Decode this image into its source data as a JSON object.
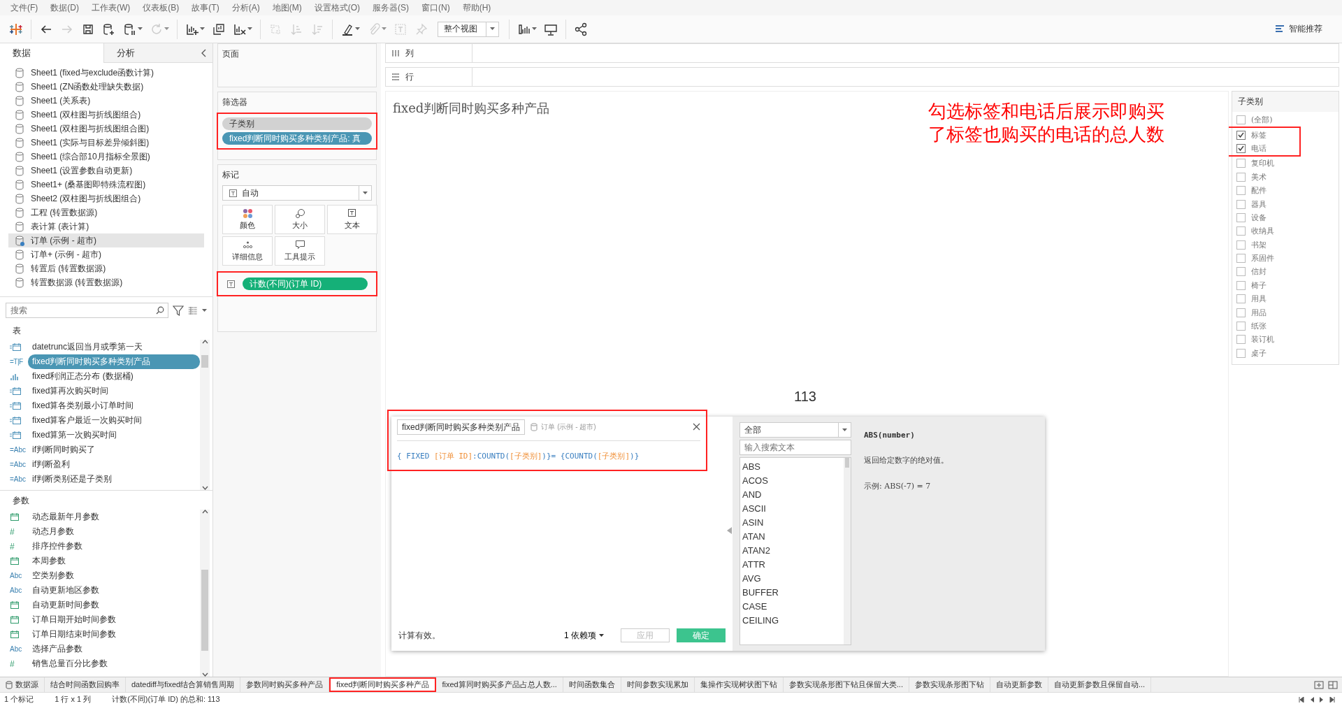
{
  "menu": [
    "文件(F)",
    "数据(D)",
    "工作表(W)",
    "仪表板(B)",
    "故事(T)",
    "分析(A)",
    "地图(M)",
    "设置格式(O)",
    "服务器(S)",
    "窗口(N)",
    "帮助(H)"
  ],
  "toolbar": {
    "items": [
      {
        "disabled": false
      },
      {
        "disabled": false
      },
      {
        "disabled": true
      },
      {
        "disabled": false
      },
      {
        "disabled": false
      },
      {
        "disabled": false
      },
      {
        "disabled": true
      },
      {
        "disabled": false
      },
      {
        "disabled": false
      },
      {
        "disabled": false
      },
      {
        "disabled": true
      },
      {
        "disabled": true
      },
      {
        "disabled": true
      },
      {
        "disabled": false
      },
      {
        "disabled": true
      },
      {
        "disabled": true
      },
      {
        "disabled": true
      },
      {
        "disabled": false
      },
      {
        "disabled": false
      },
      {
        "disabled": false
      },
      {
        "disabled": false
      }
    ],
    "fit_value": "整个视图",
    "show_me": "智能推荐"
  },
  "data_pane": {
    "tabs": [
      {
        "label": "数据",
        "selected": true
      },
      {
        "label": "分析",
        "selected": false
      }
    ],
    "data_sources": [
      {
        "label": "Sheet1 (fixed与exclude函数计算)",
        "selected": false
      },
      {
        "label": "Sheet1 (ZN函数处理缺失数据)",
        "selected": false
      },
      {
        "label": "Sheet1 (关系表)",
        "selected": false
      },
      {
        "label": "Sheet1 (双柱图与折线图组合)",
        "selected": false
      },
      {
        "label": "Sheet1 (双柱图与折线图组合图)",
        "selected": false
      },
      {
        "label": "Sheet1 (实际与目标差异倾斜图)",
        "selected": false
      },
      {
        "label": "Sheet1 (综合部10月指标全景图)",
        "selected": false
      },
      {
        "label": "Sheet1 (设置参数自动更新)",
        "selected": false
      },
      {
        "label": "Sheet1+ (桑基图即特殊流程图)",
        "selected": false
      },
      {
        "label": "Sheet2 (双柱图与折线图组合)",
        "selected": false
      },
      {
        "label": "工程 (转置数据源)",
        "selected": false
      },
      {
        "label": "表计算 (表计算)",
        "selected": false
      },
      {
        "label": "订单 (示例 - 超市)",
        "selected": true
      },
      {
        "label": "订单+ (示例 - 超市)",
        "selected": false
      },
      {
        "label": "转置后 (转置数据源)",
        "selected": false
      },
      {
        "label": "转置数据源 (转置数据源)",
        "selected": false
      }
    ],
    "search": {
      "placeholder": "搜索"
    },
    "tables_heading": "表",
    "fields": [
      {
        "kind": "date-calc",
        "label": "datetrunc返回当月或季第一天",
        "selected": false
      },
      {
        "kind": "bool-calc",
        "badge": "=T|F",
        "label": "fixed判断同时购买多种类别产品",
        "selected": true
      },
      {
        "kind": "bins",
        "label": "fixed利润正态分布 (数据桶)",
        "selected": false
      },
      {
        "kind": "date-calc",
        "label": "fixed算再次购买时间",
        "selected": false
      },
      {
        "kind": "date-calc",
        "label": "fixed算各类别最小订单时间",
        "selected": false
      },
      {
        "kind": "date-calc",
        "label": "fixed算客户最近一次购买时间",
        "selected": false
      },
      {
        "kind": "date-calc",
        "label": "fixed算第一次购买时间",
        "selected": false
      },
      {
        "kind": "string-calc",
        "badge": "=Abc",
        "label": "if判断同时购买了",
        "selected": false
      },
      {
        "kind": "string-calc",
        "badge": "=Abc",
        "label": "if判断盈利",
        "selected": false
      },
      {
        "kind": "string-calc",
        "badge": "=Abc",
        "label": "if判断类别还是子类别",
        "selected": false
      }
    ],
    "params_heading": "参数",
    "parameters": [
      {
        "kind": "date",
        "label": "动态最新年月参数"
      },
      {
        "kind": "number",
        "badge": "#",
        "label": "动态月参数"
      },
      {
        "kind": "number",
        "badge": "#",
        "label": "排序控件参数"
      },
      {
        "kind": "date",
        "label": "本周参数"
      },
      {
        "kind": "string",
        "badge": "Abc",
        "label": "空类别参数"
      },
      {
        "kind": "string",
        "badge": "Abc",
        "label": "自动更新地区参数"
      },
      {
        "kind": "date",
        "label": "自动更新时间参数"
      },
      {
        "kind": "date",
        "label": "订单日期开始时间参数"
      },
      {
        "kind": "date",
        "label": "订单日期结束时间参数"
      },
      {
        "kind": "string",
        "badge": "Abc",
        "label": "选择产品参数"
      },
      {
        "kind": "number",
        "badge": "#",
        "label": "销售总量百分比参数"
      }
    ]
  },
  "pages_card": {
    "title": "页面"
  },
  "filters_card": {
    "title": "筛选器",
    "highlighted": true,
    "pills": [
      {
        "label": "子类别",
        "kind": "dimension"
      },
      {
        "label": "fixed判断同时购买多种类别产品: 真",
        "kind": "calc"
      }
    ]
  },
  "marks_card": {
    "title": "标记",
    "mark_type": "自动",
    "highlighted": true,
    "buttons": [
      "颜色",
      "大小",
      "文本",
      "详细信息",
      "工具提示"
    ],
    "pills": [
      {
        "label": "计数(不同)(订单 ID)",
        "kind": "measure"
      }
    ]
  },
  "columns_shelf": {
    "label": "列"
  },
  "rows_shelf": {
    "label": "行"
  },
  "sheet": {
    "title": "fixed判断同时购买多种产品",
    "value": "113",
    "annotation": [
      "勾选标签和电话后展示即购买",
      "了标签也购买的电话的总人数"
    ]
  },
  "calc_editor": {
    "highlighted": true,
    "name": "fixed判断同时购买多种类别产品",
    "source": "订单 (示例 - 超市)",
    "formula": [
      {
        "kind": "keyword",
        "text": "{ FIXED "
      },
      {
        "kind": "field",
        "text": "[订单 ID]"
      },
      {
        "kind": "keyword",
        "text": ":COUNTD("
      },
      {
        "kind": "field",
        "text": "[子类别]"
      },
      {
        "kind": "keyword",
        "text": ")}= {COUNTD("
      },
      {
        "kind": "field",
        "text": "[子类别]"
      },
      {
        "kind": "keyword",
        "text": ")}"
      }
    ],
    "status": "计算有效。",
    "dependencies": "1 依赖项",
    "apply": "应用",
    "ok": "确定",
    "category": "全部",
    "search_placeholder": "输入搜索文本",
    "functions": [
      "ABS",
      "ACOS",
      "AND",
      "ASCII",
      "ASIN",
      "ATAN",
      "ATAN2",
      "ATTR",
      "AVG",
      "BUFFER",
      "CASE",
      "CEILING"
    ],
    "help_signature": "ABS(number)",
    "help_text": "返回给定数字的绝对值。",
    "help_example": "示例: ABS(-7) = 7"
  },
  "filter_card": {
    "title": "子类别",
    "items": [
      {
        "label": "(全部)",
        "checked": false,
        "highlighted": false
      },
      {
        "label": "标签",
        "checked": true,
        "highlighted": true
      },
      {
        "label": "电话",
        "checked": true,
        "highlighted": true
      },
      {
        "label": "复印机",
        "checked": false,
        "highlighted": false
      },
      {
        "label": "美术",
        "checked": false,
        "highlighted": false
      },
      {
        "label": "配件",
        "checked": false,
        "highlighted": false
      },
      {
        "label": "器具",
        "checked": false,
        "highlighted": false
      },
      {
        "label": "设备",
        "checked": false,
        "highlighted": false
      },
      {
        "label": "收纳具",
        "checked": false,
        "highlighted": false
      },
      {
        "label": "书架",
        "checked": false,
        "highlighted": false
      },
      {
        "label": "系固件",
        "checked": false,
        "highlighted": false
      },
      {
        "label": "信封",
        "checked": false,
        "highlighted": false
      },
      {
        "label": "椅子",
        "checked": false,
        "highlighted": false
      },
      {
        "label": "用具",
        "checked": false,
        "highlighted": false
      },
      {
        "label": "用品",
        "checked": false,
        "highlighted": false
      },
      {
        "label": "纸张",
        "checked": false,
        "highlighted": false
      },
      {
        "label": "装订机",
        "checked": false,
        "highlighted": false
      },
      {
        "label": "桌子",
        "checked": false,
        "highlighted": false
      }
    ]
  },
  "sheet_tabs": [
    {
      "label": "数据源",
      "kind": "datasource",
      "selected": false,
      "highlighted": false
    },
    {
      "label": "结合时间函数回购率",
      "kind": "sheet",
      "selected": false,
      "highlighted": false
    },
    {
      "label": "datediff与fixed结合算销售周期",
      "kind": "sheet",
      "selected": false,
      "highlighted": false
    },
    {
      "label": "参数同时购买多种产品",
      "kind": "sheet",
      "selected": false,
      "highlighted": false
    },
    {
      "label": "fixed判断同时购买多种产品",
      "kind": "sheet",
      "selected": true,
      "highlighted": true
    },
    {
      "label": "fixed算同时购买多产品占总人数...",
      "kind": "sheet",
      "selected": false,
      "highlighted": false
    },
    {
      "label": "时间函数集合",
      "kind": "sheet",
      "selected": false,
      "highlighted": false
    },
    {
      "label": "时间参数实现累加",
      "kind": "sheet",
      "selected": false,
      "highlighted": false
    },
    {
      "label": "集操作实现树状图下钻",
      "kind": "sheet",
      "selected": false,
      "highlighted": false
    },
    {
      "label": "参数实现条形图下钻且保留大类...",
      "kind": "sheet",
      "selected": false,
      "highlighted": false
    },
    {
      "label": "参数实现条形图下钻",
      "kind": "sheet",
      "selected": false,
      "highlighted": false
    },
    {
      "label": "自动更新参数",
      "kind": "sheet",
      "selected": false,
      "highlighted": false
    },
    {
      "label": "自动更新参数且保留自动...",
      "kind": "sheet",
      "selected": false,
      "highlighted": false
    }
  ],
  "status_bar": [
    "1 个标记",
    "1 行 x 1 列",
    "计数(不同)(订单 ID) 的总和: 113"
  ]
}
